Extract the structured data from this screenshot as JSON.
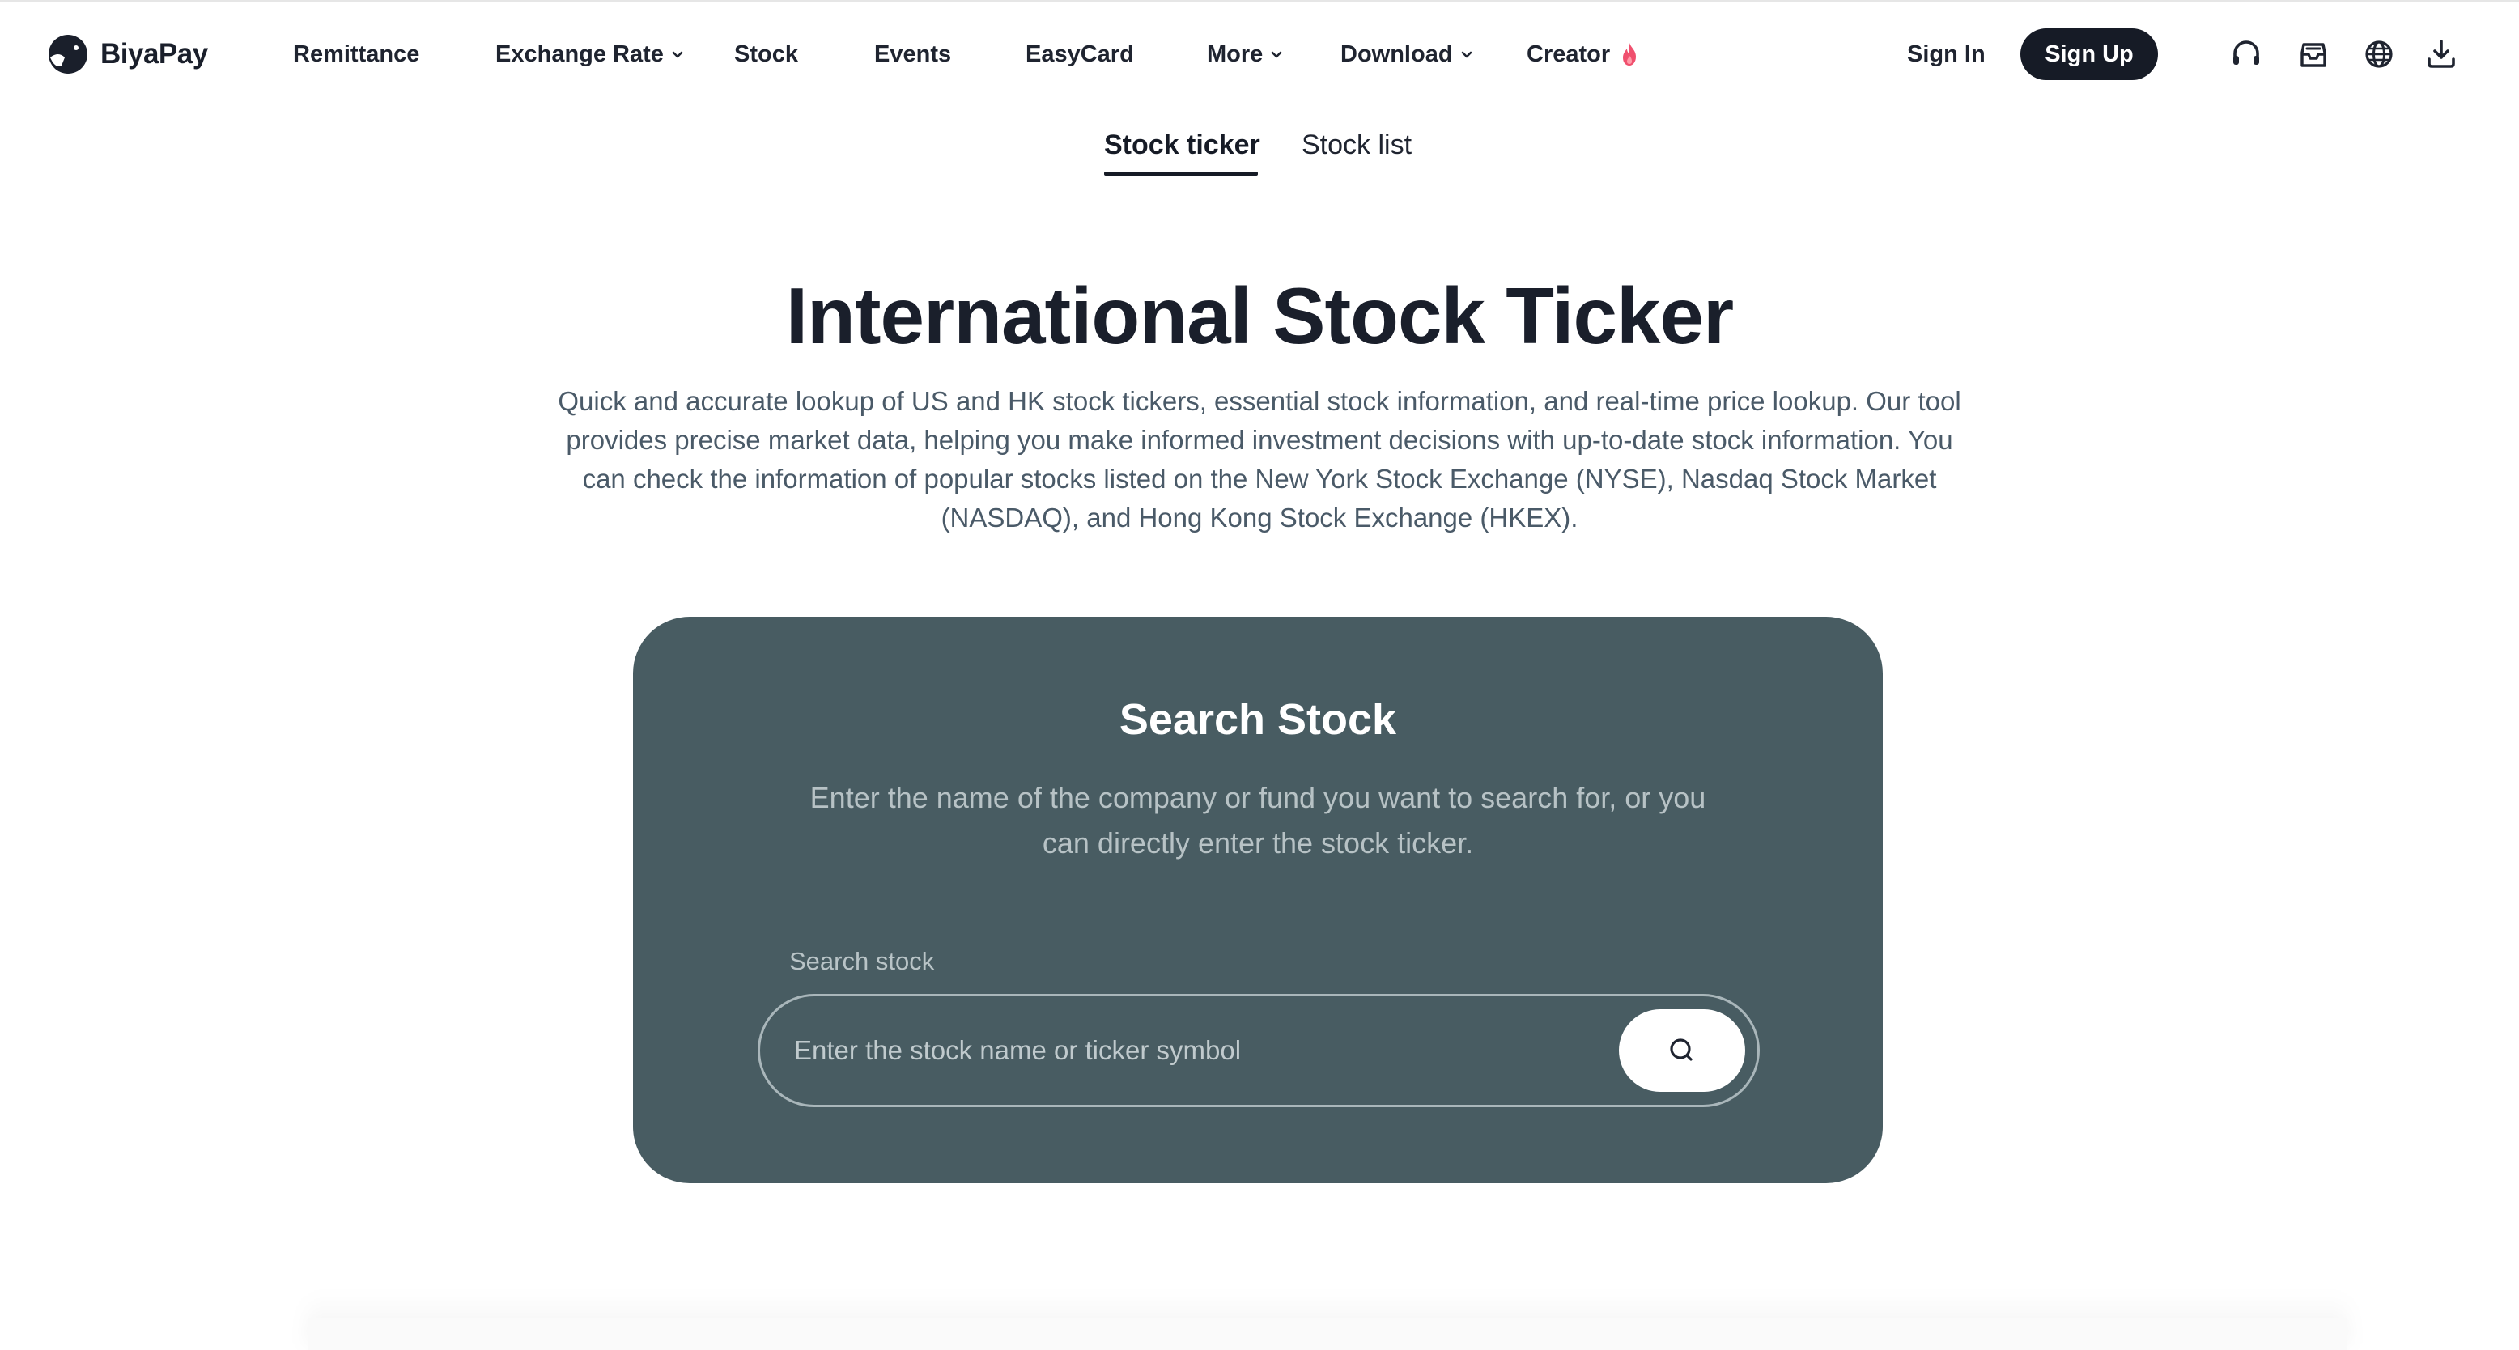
{
  "header": {
    "logo_text": "BiyaPay",
    "nav": {
      "remittance": "Remittance",
      "exchange_rate": "Exchange Rate",
      "stock": "Stock",
      "events": "Events",
      "easycard": "EasyCard",
      "more": "More",
      "download": "Download",
      "creator": "Creator"
    },
    "sign_in": "Sign In",
    "sign_up": "Sign Up",
    "icons": [
      "headset-icon",
      "mailbox-icon",
      "globe-icon",
      "download-icon"
    ]
  },
  "tabs": {
    "active": "Stock ticker",
    "inactive": "Stock list"
  },
  "hero": {
    "title": "International Stock Ticker",
    "description": "Quick and accurate lookup of US and HK stock tickers, essential stock information, and real-time price lookup. Our tool provides precise market data, helping you make informed investment decisions with up-to-date stock information. You can check the information of popular stocks listed on the New York Stock Exchange (NYSE), Nasdaq Stock Market (NASDAQ), and Hong Kong Stock Exchange (HKEX)."
  },
  "search_card": {
    "title": "Search Stock",
    "description": "Enter the name of the company or fund you want to search for, or you can directly enter the stock ticker.",
    "field_label": "Search stock",
    "input_value": "",
    "input_placeholder": "Enter the stock name or ticker symbol"
  },
  "colors": {
    "card_bg": "#485c62",
    "primary_dark": "#161b26",
    "text_muted": "#4a5a68"
  }
}
